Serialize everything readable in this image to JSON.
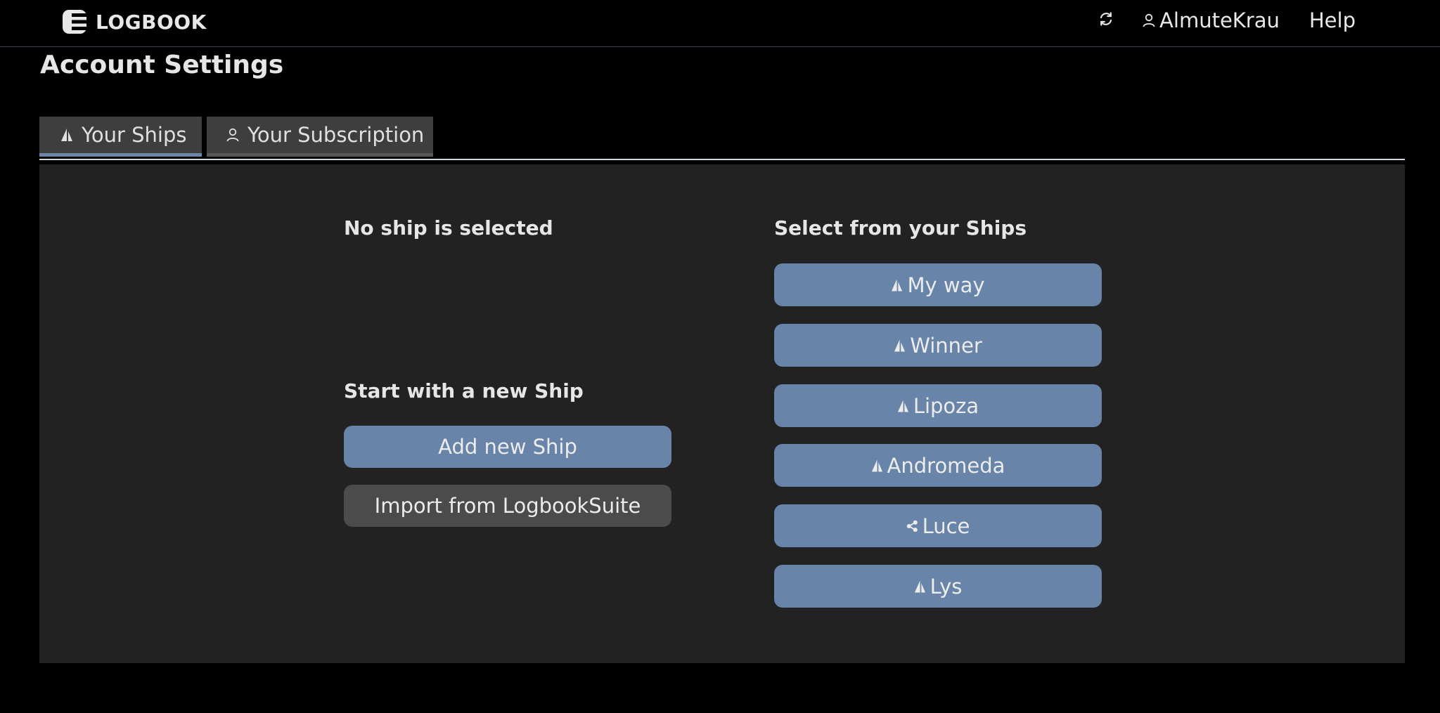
{
  "header": {
    "brand": "LOGBOOK",
    "user_name": "AlmuteKrau",
    "help_label": "Help"
  },
  "page": {
    "title": "Account Settings"
  },
  "tabs": [
    {
      "label": "Your Ships",
      "icon": "sailboat-icon",
      "active": true
    },
    {
      "label": "Your Subscription",
      "icon": "user-icon",
      "active": false
    }
  ],
  "left_column": {
    "status_heading": "No ship is selected",
    "new_ship_heading": "Start with a new Ship",
    "add_button": "Add new Ship",
    "import_button": "Import from LogbookSuite"
  },
  "right_column": {
    "heading": "Select from your Ships",
    "ships": [
      {
        "name": "My way",
        "icon": "sailboat-icon"
      },
      {
        "name": "Winner",
        "icon": "sailboat-icon"
      },
      {
        "name": "Lipoza",
        "icon": "sailboat-icon"
      },
      {
        "name": "Andromeda",
        "icon": "sailboat-icon"
      },
      {
        "name": "Luce",
        "icon": "share-icon"
      },
      {
        "name": "Lys",
        "icon": "sailboat-icon"
      }
    ]
  },
  "colors": {
    "background": "#000000",
    "panel": "#222222",
    "primary_button": "#6884a8",
    "secondary_button": "#4b4b4b",
    "tab_background": "#3e3e3e",
    "active_tab_indicator": "#6a86a8"
  }
}
